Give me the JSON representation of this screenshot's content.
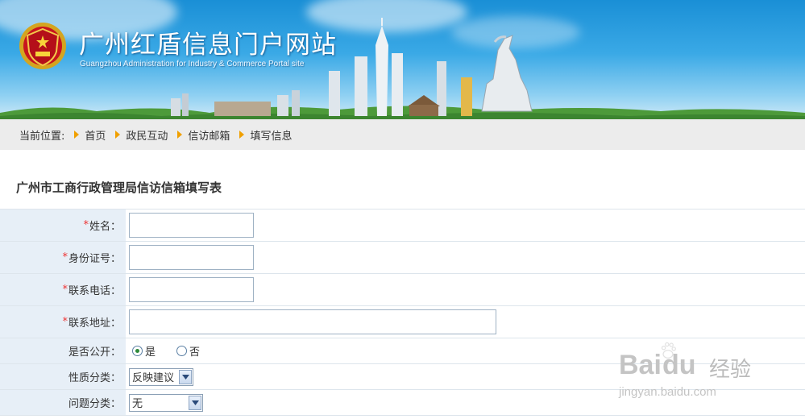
{
  "banner": {
    "title": "广州红盾信息门户网站",
    "subtitle": "Guangzhou Administration for Industry & Commerce Portal site"
  },
  "breadcrumb": {
    "label": "当前位置:",
    "items": [
      "首页",
      "政民互动",
      "信访邮箱",
      "填写信息"
    ]
  },
  "form": {
    "title": "广州市工商行政管理局信访信箱填写表",
    "required_mark": "*",
    "name_label": "姓名：",
    "name_value": "",
    "id_label": "身份证号：",
    "id_value": "",
    "phone_label": "联系电话：",
    "phone_value": "",
    "address_label": "联系地址：",
    "address_value": "",
    "public_label": "是否公开：",
    "public_yes": "是",
    "public_no": "否",
    "public_selected": "是",
    "nature_label": "性质分类：",
    "nature_value": "反映建议",
    "issue_label": "问题分类：",
    "issue_value": "无"
  },
  "watermark": {
    "brand": "Bai",
    "brand2": "du",
    "tag": "经验",
    "url": "jingyan.baidu.com"
  },
  "colors": {
    "accent_orange": "#f0a000",
    "required_red": "#e33333",
    "label_bg": "#e7eff7",
    "crumb_bg": "#ececec"
  }
}
